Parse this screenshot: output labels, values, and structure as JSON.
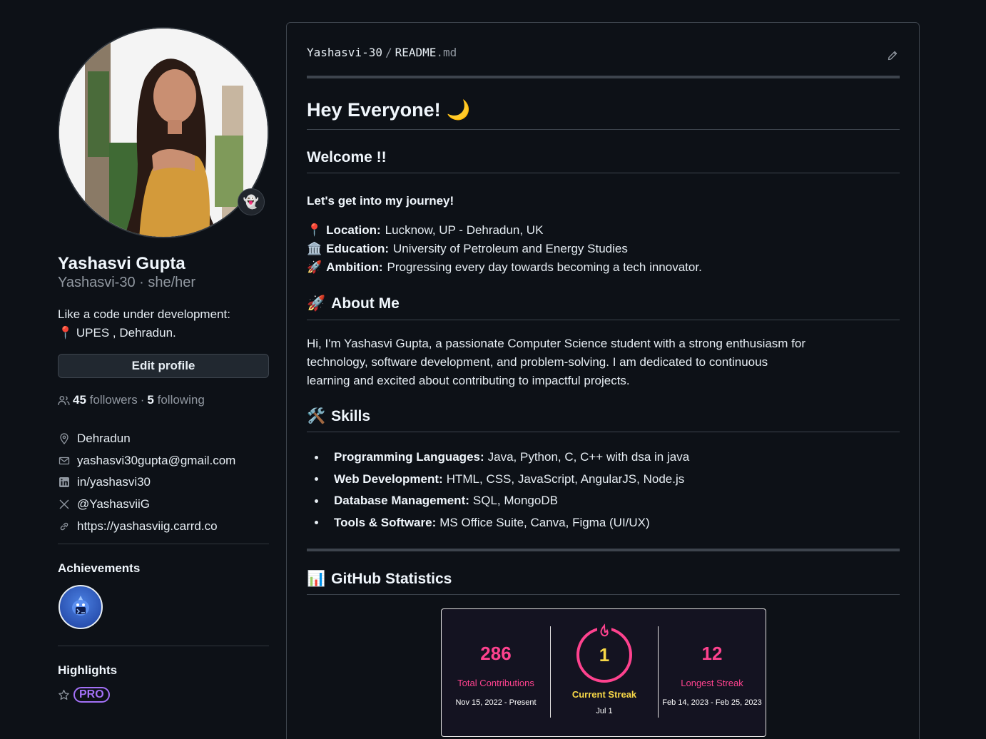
{
  "profile": {
    "name": "Yashasvi Gupta",
    "username": "Yashasvi-30",
    "pronouns": "she/her",
    "handle_line": "Yashasvi-30 · she/her",
    "bio_line1": "Like a code under development:",
    "bio_line2": "UPES , Dehradun.",
    "bio_line2_emoji": "📍",
    "status_emoji": "👻",
    "edit_label": "Edit profile",
    "followers_count": "45",
    "followers_label": "followers",
    "follow_sep": "·",
    "following_count": "5",
    "following_label": "following",
    "details": [
      {
        "icon": "location-icon",
        "text": "Dehradun"
      },
      {
        "icon": "mail-icon",
        "text": "yashasvi30gupta@gmail.com"
      },
      {
        "icon": "linkedin-icon",
        "text": "in/yashasvi30"
      },
      {
        "icon": "x-icon",
        "text": "@YashasviiG"
      },
      {
        "icon": "link-icon",
        "text": "https://yashasviig.carrd.co"
      }
    ],
    "achievements_title": "Achievements",
    "highlights_title": "Highlights",
    "pro_label": "PRO"
  },
  "readme": {
    "repo": "Yashasvi-30",
    "separator": "/",
    "file_name": "README",
    "file_ext": ".md",
    "h1": "Hey Everyone!",
    "h1_emoji": "🌙",
    "welcome": "Welcome !!",
    "journey": "Let's get into my journey!",
    "info": [
      {
        "emoji": "📍",
        "label": "Location:",
        "value": "Lucknow, UP - Dehradun, UK"
      },
      {
        "emoji": "🏛️",
        "label": "Education:",
        "value": "University of Petroleum and Energy Studies"
      },
      {
        "emoji": "🚀",
        "label": "Ambition:",
        "value": "Progressing every day towards becoming a tech innovator."
      }
    ],
    "about_emoji": "🚀",
    "about_title": "About Me",
    "about_l1": "Hi, I'm Yashasvi Gupta, a passionate Computer Science student with a strong enthusiasm for",
    "about_l2": "technology, software development, and problem-solving. I am dedicated to continuous",
    "about_l3": "learning and excited about contributing to impactful projects.",
    "skills_emoji": "🛠️",
    "skills_title": "Skills",
    "skills": [
      {
        "label": "Programming Languages:",
        "value": "Java, Python, C, C++ with dsa in java"
      },
      {
        "label": "Web Development:",
        "value": "HTML, CSS, JavaScript, AngularJS, Node.js"
      },
      {
        "label": "Database Management:",
        "value": "SQL, MongoDB"
      },
      {
        "label": "Tools & Software:",
        "value": "MS Office Suite, Canva, Figma (UI/UX)"
      }
    ],
    "stats_emoji": "📊",
    "stats_title": "GitHub Statistics",
    "streak": {
      "total": "286",
      "total_label": "Total Contributions",
      "total_range": "Nov 15, 2022 - Present",
      "current": "1",
      "current_label": "Current Streak",
      "current_range": "Jul 1",
      "longest": "12",
      "longest_label": "Longest Streak",
      "longest_range": "Feb 14, 2023 - Feb 25, 2023"
    }
  },
  "colors": {
    "background": "#0d1117",
    "border": "#3d444d",
    "pro_accent": "#a371f7",
    "streak_pink": "#fe428e",
    "streak_yellow": "#f8d847",
    "streak_bg": "#141321"
  }
}
